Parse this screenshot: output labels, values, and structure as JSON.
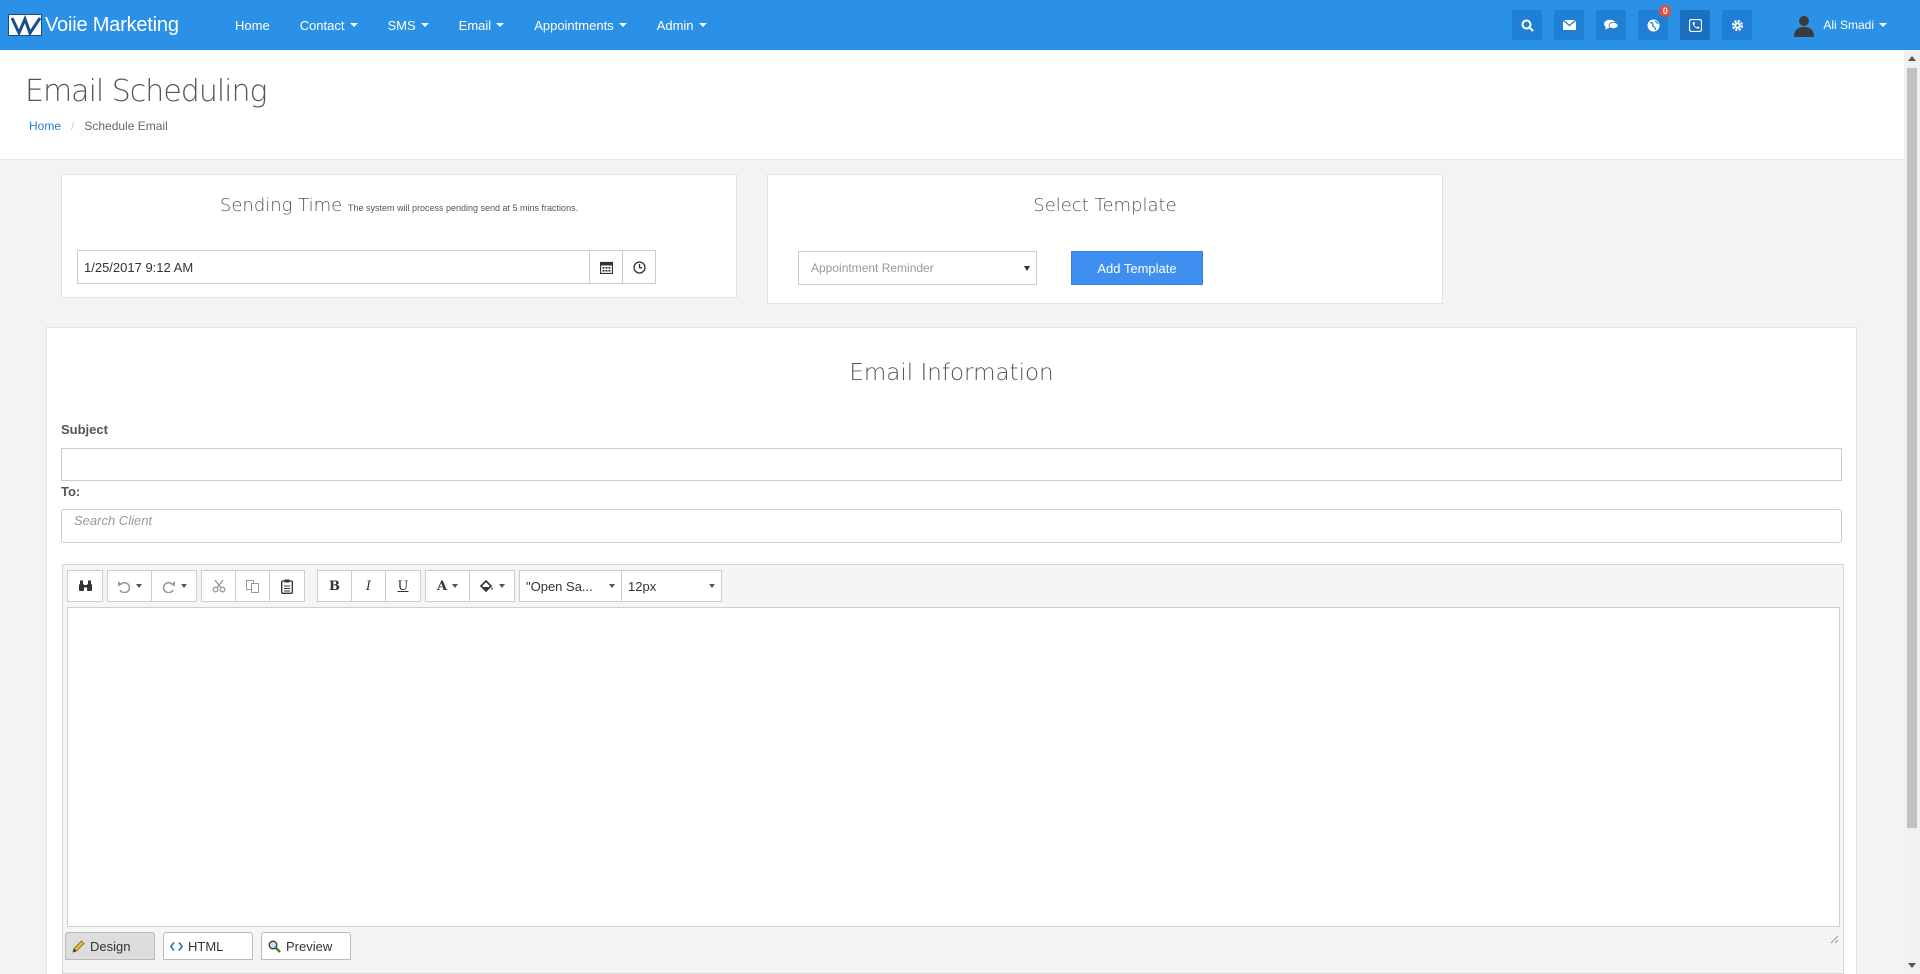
{
  "navbar": {
    "brand": "Voiie Marketing",
    "menu": [
      {
        "label": "Home",
        "has_caret": false
      },
      {
        "label": "Contact",
        "has_caret": true
      },
      {
        "label": "SMS",
        "has_caret": true
      },
      {
        "label": "Email",
        "has_caret": true
      },
      {
        "label": "Appointments",
        "has_caret": true
      },
      {
        "label": "Admin",
        "has_caret": true
      }
    ],
    "notification_count": "0",
    "user_name": "Ali Smadi",
    "icons": [
      "search-icon",
      "envelope-icon",
      "comments-icon",
      "globe-icon",
      "phone-icon",
      "gear-icon"
    ],
    "color": "#2b91e6"
  },
  "header": {
    "title": "Email Scheduling",
    "breadcrumb_home": "Home",
    "breadcrumb_current": "Schedule Email"
  },
  "sending_time": {
    "title": "Sending Time",
    "note": "The system will process pending send at 5 mins fractions.",
    "value": "1/25/2017 9:12 AM"
  },
  "template": {
    "title": "Select Template",
    "selected": "Appointment Reminder",
    "add_button": "Add Template"
  },
  "email_info": {
    "title": "Email Information",
    "subject_label": "Subject",
    "subject_value": "",
    "to_label": "To:",
    "to_placeholder": "Search Client"
  },
  "editor": {
    "font_family": "\"Open Sa...",
    "font_size": "12px",
    "bold": "B",
    "italic": "I",
    "underline": "U",
    "font_color": "A",
    "tabs": {
      "design": "Design",
      "html": "HTML",
      "preview": "Preview"
    },
    "active_tab": "Design"
  }
}
